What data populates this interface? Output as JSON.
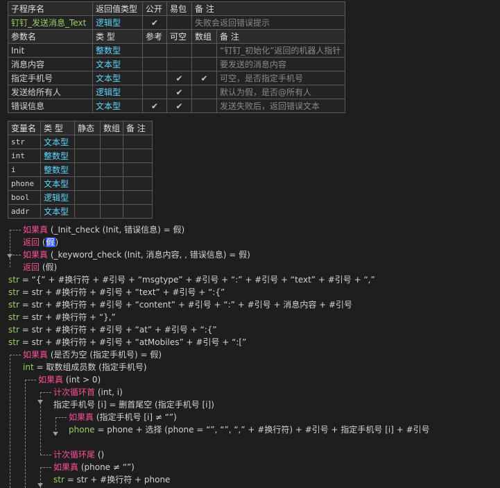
{
  "sub_table": {
    "headers": [
      "子程序名",
      "返回值类型",
      "公开",
      "易包",
      "备 注"
    ],
    "row": {
      "name": "钉钉_发送消息_Text",
      "type": "逻辑型",
      "public": "✔",
      "easy": "",
      "note": "失败会返回错误提示"
    },
    "param_headers": [
      "参数名",
      "类 型",
      "参考",
      "可空",
      "数组",
      "备 注"
    ],
    "params": [
      {
        "name": "Init",
        "type": "整数型",
        "ref": "",
        "nullable": "",
        "array": "",
        "note": "“钉钉_初始化”返回的机器人指针"
      },
      {
        "name": "消息内容",
        "type": "文本型",
        "ref": "",
        "nullable": "",
        "array": "",
        "note": "要发送的消息内容"
      },
      {
        "name": "指定手机号",
        "type": "文本型",
        "ref": "",
        "nullable": "✔",
        "array": "✔",
        "note": "可空，是否指定手机号"
      },
      {
        "name": "发送给所有人",
        "type": "逻辑型",
        "ref": "",
        "nullable": "✔",
        "array": "",
        "note": "默认为假，是否@所有人"
      },
      {
        "name": "错误信息",
        "type": "文本型",
        "ref": "✔",
        "nullable": "✔",
        "array": "",
        "note": "发送失败后，返回错误文本"
      }
    ]
  },
  "var_table": {
    "headers": [
      "变量名",
      "类 型",
      "静态",
      "数组",
      "备 注"
    ],
    "vars": [
      {
        "name": "str",
        "type": "文本型"
      },
      {
        "name": "int",
        "type": "整数型"
      },
      {
        "name": "i",
        "type": "整数型"
      },
      {
        "name": "phone",
        "type": "文本型"
      },
      {
        "name": "bool",
        "type": "逻辑型"
      },
      {
        "name": "addr",
        "type": "文本型"
      }
    ]
  },
  "code": {
    "l1": {
      "kw": "如果真",
      "body": " (_Init_check (Init, 错误信息) = 假)"
    },
    "l2": {
      "kw": "返回",
      "pre": " (",
      "hl": "假",
      "post": ")"
    },
    "l3": {
      "kw": "如果真",
      "body": " (_keyword_check (Init, 消息内容, , 错误信息) = 假)"
    },
    "l4": {
      "kw": "返回",
      "body": " (假)"
    },
    "l5": {
      "var": "str",
      "body": " = “{” + #换行符 + #引号 + “msgtype” + #引号 + “:” + #引号 + “text” + #引号 + “,”"
    },
    "l6": {
      "var": "str",
      "body": " = str + #换行符 + #引号 + “text” + #引号 + “:{”"
    },
    "l7": {
      "var": "str",
      "body": " = str + #换行符 + #引号 + “content” + #引号 + “:” + #引号 + 消息内容 + #引号"
    },
    "l8": {
      "var": "str",
      "body": " = str + #换行符 + “},”"
    },
    "l9": {
      "var": "str",
      "body": " = str + #换行符 + #引号 + “at” + #引号 + “:{”"
    },
    "l10": {
      "var": "str",
      "body": " = str + #换行符 + #引号 + “atMobiles” + #引号 + “:[”"
    },
    "l11": {
      "kw": "如果真",
      "body": " (是否为空 (指定手机号) = 假)"
    },
    "l12": {
      "var": "int",
      "body": " = 取数组成员数 (指定手机号)"
    },
    "l13": {
      "kw": "如果真",
      "body": " (int > 0)"
    },
    "l14": {
      "kw": "计次循环首",
      "body": " (int, i)"
    },
    "l15": {
      "body": "指定手机号 [i] = 删首尾空 (指定手机号 [i])"
    },
    "l16": {
      "kw": "如果真",
      "body": " (指定手机号 [i] ≠ “”)"
    },
    "l17": {
      "var": "phone",
      "body": " = phone + 选择 (phone = “”, “”, “,” + #换行符) + #引号 + 指定手机号 [i] + #引号"
    },
    "l18": {
      "kw": "计次循环尾",
      "body": " ()"
    },
    "l19": {
      "kw": "如果真",
      "body": " (phone ≠ “”)"
    },
    "l20": {
      "var": "str",
      "body": " = str + #换行符 + phone"
    }
  }
}
